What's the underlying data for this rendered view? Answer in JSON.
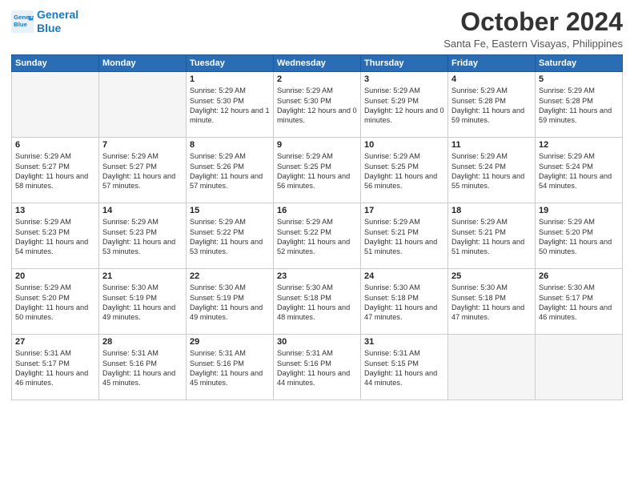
{
  "logo": {
    "line1": "General",
    "line2": "Blue"
  },
  "title": "October 2024",
  "location": "Santa Fe, Eastern Visayas, Philippines",
  "days_of_week": [
    "Sunday",
    "Monday",
    "Tuesday",
    "Wednesday",
    "Thursday",
    "Friday",
    "Saturday"
  ],
  "weeks": [
    [
      {
        "day": "",
        "info": ""
      },
      {
        "day": "",
        "info": ""
      },
      {
        "day": "1",
        "sunrise": "Sunrise: 5:29 AM",
        "sunset": "Sunset: 5:30 PM",
        "daylight": "Daylight: 12 hours and 1 minute."
      },
      {
        "day": "2",
        "sunrise": "Sunrise: 5:29 AM",
        "sunset": "Sunset: 5:30 PM",
        "daylight": "Daylight: 12 hours and 0 minutes."
      },
      {
        "day": "3",
        "sunrise": "Sunrise: 5:29 AM",
        "sunset": "Sunset: 5:29 PM",
        "daylight": "Daylight: 12 hours and 0 minutes."
      },
      {
        "day": "4",
        "sunrise": "Sunrise: 5:29 AM",
        "sunset": "Sunset: 5:28 PM",
        "daylight": "Daylight: 11 hours and 59 minutes."
      },
      {
        "day": "5",
        "sunrise": "Sunrise: 5:29 AM",
        "sunset": "Sunset: 5:28 PM",
        "daylight": "Daylight: 11 hours and 59 minutes."
      }
    ],
    [
      {
        "day": "6",
        "sunrise": "Sunrise: 5:29 AM",
        "sunset": "Sunset: 5:27 PM",
        "daylight": "Daylight: 11 hours and 58 minutes."
      },
      {
        "day": "7",
        "sunrise": "Sunrise: 5:29 AM",
        "sunset": "Sunset: 5:27 PM",
        "daylight": "Daylight: 11 hours and 57 minutes."
      },
      {
        "day": "8",
        "sunrise": "Sunrise: 5:29 AM",
        "sunset": "Sunset: 5:26 PM",
        "daylight": "Daylight: 11 hours and 57 minutes."
      },
      {
        "day": "9",
        "sunrise": "Sunrise: 5:29 AM",
        "sunset": "Sunset: 5:25 PM",
        "daylight": "Daylight: 11 hours and 56 minutes."
      },
      {
        "day": "10",
        "sunrise": "Sunrise: 5:29 AM",
        "sunset": "Sunset: 5:25 PM",
        "daylight": "Daylight: 11 hours and 56 minutes."
      },
      {
        "day": "11",
        "sunrise": "Sunrise: 5:29 AM",
        "sunset": "Sunset: 5:24 PM",
        "daylight": "Daylight: 11 hours and 55 minutes."
      },
      {
        "day": "12",
        "sunrise": "Sunrise: 5:29 AM",
        "sunset": "Sunset: 5:24 PM",
        "daylight": "Daylight: 11 hours and 54 minutes."
      }
    ],
    [
      {
        "day": "13",
        "sunrise": "Sunrise: 5:29 AM",
        "sunset": "Sunset: 5:23 PM",
        "daylight": "Daylight: 11 hours and 54 minutes."
      },
      {
        "day": "14",
        "sunrise": "Sunrise: 5:29 AM",
        "sunset": "Sunset: 5:23 PM",
        "daylight": "Daylight: 11 hours and 53 minutes."
      },
      {
        "day": "15",
        "sunrise": "Sunrise: 5:29 AM",
        "sunset": "Sunset: 5:22 PM",
        "daylight": "Daylight: 11 hours and 53 minutes."
      },
      {
        "day": "16",
        "sunrise": "Sunrise: 5:29 AM",
        "sunset": "Sunset: 5:22 PM",
        "daylight": "Daylight: 11 hours and 52 minutes."
      },
      {
        "day": "17",
        "sunrise": "Sunrise: 5:29 AM",
        "sunset": "Sunset: 5:21 PM",
        "daylight": "Daylight: 11 hours and 51 minutes."
      },
      {
        "day": "18",
        "sunrise": "Sunrise: 5:29 AM",
        "sunset": "Sunset: 5:21 PM",
        "daylight": "Daylight: 11 hours and 51 minutes."
      },
      {
        "day": "19",
        "sunrise": "Sunrise: 5:29 AM",
        "sunset": "Sunset: 5:20 PM",
        "daylight": "Daylight: 11 hours and 50 minutes."
      }
    ],
    [
      {
        "day": "20",
        "sunrise": "Sunrise: 5:29 AM",
        "sunset": "Sunset: 5:20 PM",
        "daylight": "Daylight: 11 hours and 50 minutes."
      },
      {
        "day": "21",
        "sunrise": "Sunrise: 5:30 AM",
        "sunset": "Sunset: 5:19 PM",
        "daylight": "Daylight: 11 hours and 49 minutes."
      },
      {
        "day": "22",
        "sunrise": "Sunrise: 5:30 AM",
        "sunset": "Sunset: 5:19 PM",
        "daylight": "Daylight: 11 hours and 49 minutes."
      },
      {
        "day": "23",
        "sunrise": "Sunrise: 5:30 AM",
        "sunset": "Sunset: 5:18 PM",
        "daylight": "Daylight: 11 hours and 48 minutes."
      },
      {
        "day": "24",
        "sunrise": "Sunrise: 5:30 AM",
        "sunset": "Sunset: 5:18 PM",
        "daylight": "Daylight: 11 hours and 47 minutes."
      },
      {
        "day": "25",
        "sunrise": "Sunrise: 5:30 AM",
        "sunset": "Sunset: 5:18 PM",
        "daylight": "Daylight: 11 hours and 47 minutes."
      },
      {
        "day": "26",
        "sunrise": "Sunrise: 5:30 AM",
        "sunset": "Sunset: 5:17 PM",
        "daylight": "Daylight: 11 hours and 46 minutes."
      }
    ],
    [
      {
        "day": "27",
        "sunrise": "Sunrise: 5:31 AM",
        "sunset": "Sunset: 5:17 PM",
        "daylight": "Daylight: 11 hours and 46 minutes."
      },
      {
        "day": "28",
        "sunrise": "Sunrise: 5:31 AM",
        "sunset": "Sunset: 5:16 PM",
        "daylight": "Daylight: 11 hours and 45 minutes."
      },
      {
        "day": "29",
        "sunrise": "Sunrise: 5:31 AM",
        "sunset": "Sunset: 5:16 PM",
        "daylight": "Daylight: 11 hours and 45 minutes."
      },
      {
        "day": "30",
        "sunrise": "Sunrise: 5:31 AM",
        "sunset": "Sunset: 5:16 PM",
        "daylight": "Daylight: 11 hours and 44 minutes."
      },
      {
        "day": "31",
        "sunrise": "Sunrise: 5:31 AM",
        "sunset": "Sunset: 5:15 PM",
        "daylight": "Daylight: 11 hours and 44 minutes."
      },
      {
        "day": "",
        "info": ""
      },
      {
        "day": "",
        "info": ""
      }
    ]
  ]
}
